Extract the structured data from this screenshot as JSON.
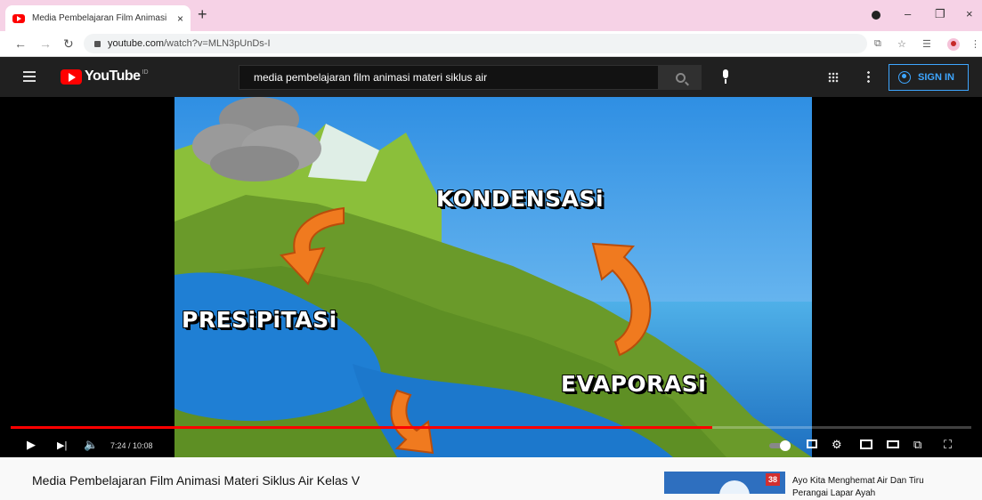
{
  "browser": {
    "tab_title": "Media Pembelajaran Film Animasi",
    "tab_close": "×",
    "new_tab": "+",
    "url_host": "youtube.com",
    "url_path": "/watch?v=MLN3pUnDs-I",
    "window_controls": {
      "minimize": "–",
      "restore": "❐",
      "close": "×"
    }
  },
  "youtube": {
    "logo_text": "YouTube",
    "logo_region": "ID",
    "search_query": "media pembelajaran film animasi materi siklus air",
    "sign_in": "SIGN IN"
  },
  "video": {
    "overlay_labels": {
      "kondensasi": "KONDENSASi",
      "presipitasi": "PRESiPiTASi",
      "evaporasi": "EVAPORASi"
    },
    "time_display": "7:24 / 10:08",
    "progress": 0.73,
    "title": "Media Pembelajaran Film Animasi Materi Siklus Air Kelas V"
  },
  "recommendation": {
    "badge": "38",
    "title": "Ayo Kita Menghemat Air Dan Tiru Perangai Lapar Ayah"
  },
  "colors": {
    "tabstrip": "#f6d2e6",
    "youtube_red": "#ff0000",
    "header_dark": "#202020",
    "signin_blue": "#3ea6ff"
  }
}
